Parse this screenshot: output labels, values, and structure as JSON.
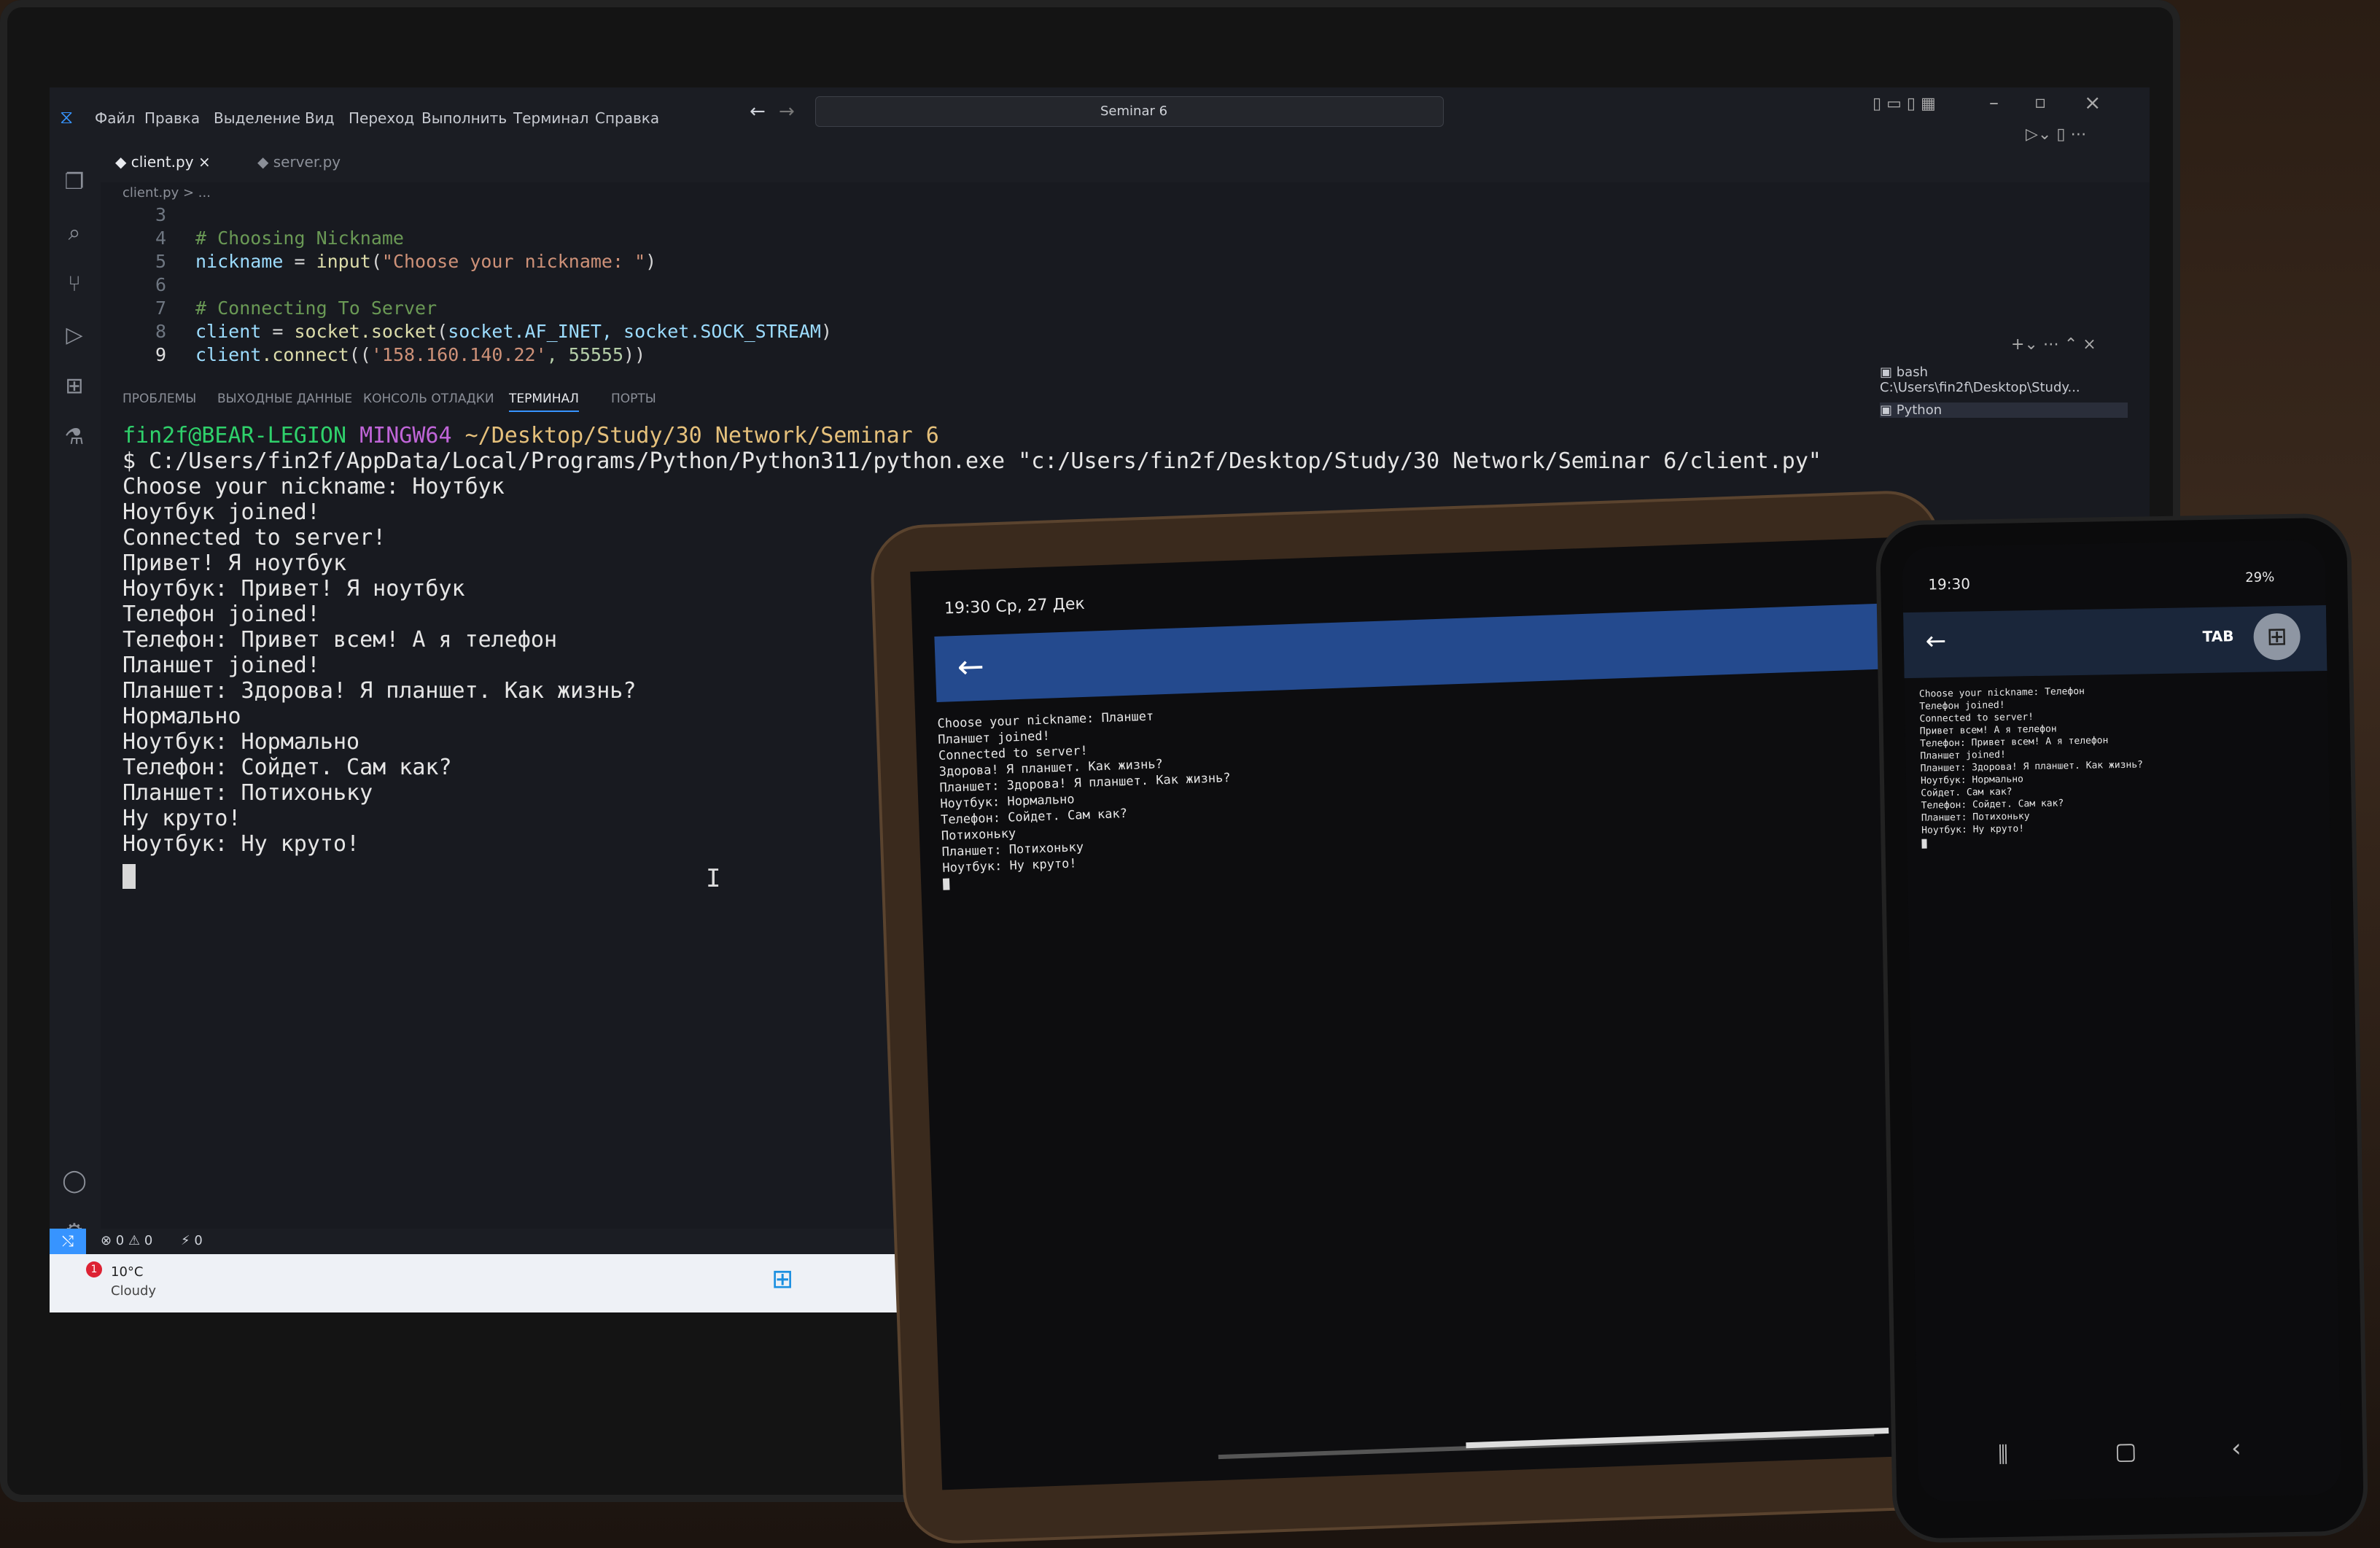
{
  "laptop": {
    "menu": [
      "Файл",
      "Правка",
      "Выделение",
      "Вид",
      "Переход",
      "Выполнить",
      "Терминал",
      "Справка"
    ],
    "search": "Seminar 6",
    "tabs": [
      {
        "label": "client.py",
        "close": "×"
      },
      {
        "label": "server.py"
      }
    ],
    "breadcrumb": "client.py > ...",
    "code": [
      {
        "n": "3"
      },
      {
        "n": "4",
        "comment": "# Choosing Nickname"
      },
      {
        "n": "5",
        "var": "nickname",
        "eq": " = ",
        "fn": "input",
        "open": "(",
        "str": "\"Choose your nickname: \"",
        "close": ")"
      },
      {
        "n": "6"
      },
      {
        "n": "7",
        "comment": "# Connecting To Server"
      },
      {
        "n": "8",
        "var": "client",
        "eq": " = ",
        "fn": "socket.socket",
        "open": "(",
        "args": "socket.AF_INET, socket.SOCK_STREAM",
        "close": ")"
      },
      {
        "n": "9",
        "var": "client",
        "fn": ".connect",
        "open": "((",
        "str": "'158.160.140.22'",
        "num": ", 55555",
        "close": "))"
      }
    ],
    "panel_tabs": [
      "ПРОБЛЕМЫ",
      "ВЫХОДНЫЕ ДАННЫЕ",
      "КОНСОЛЬ ОТЛАДКИ",
      "ТЕРМИНАЛ",
      "ПОРТЫ"
    ],
    "active_panel_tab": "ТЕРМИНАЛ",
    "terminal_list": [
      "bash C:\\Users\\fin2f\\Desktop\\Study...",
      "Python"
    ],
    "prompt": {
      "user": "fin2f@BEAR-LEGION",
      "host": "MINGW64",
      "path": "~/Desktop/Study/30 Network/Seminar 6"
    },
    "command": "$ C:/Users/fin2f/AppData/Local/Programs/Python/Python311/python.exe \"c:/Users/fin2f/Desktop/Study/30 Network/Seminar 6/client.py\"",
    "output": [
      "Choose your nickname: Ноутбук",
      "Ноутбук joined!",
      "Connected to server!",
      "Привет! Я ноутбук",
      "Ноутбук: Привет! Я ноутбук",
      "Телефон joined!",
      "Телефон: Привет всем! А я телефон",
      "Планшет joined!",
      "Планшет: Здорова! Я планшет. Как жизнь?",
      "Нормально",
      "Ноутбук: Нормально",
      "Телефон: Сойдет. Сам как?",
      "Планшет: Потихоньку",
      "Ну круто!",
      "Ноутбук: Ну круто!"
    ],
    "statusbar": {
      "errors": "⊗ 0 ⚠ 0",
      "ports": "⚡ 0"
    },
    "weather": {
      "temp": "10°C",
      "condition": "Cloudy",
      "badge": "1"
    }
  },
  "tablet": {
    "status": "19:30 Ср, 27 Дек",
    "output": [
      "Choose your nickname: Планшет",
      "Планшет joined!",
      "Connected to server!",
      "Здорова! Я планшет. Как жизнь?",
      "Планшет: Здорова! Я планшет. Как жизнь?",
      "Ноутбук: Нормально",
      "Телефон: Сойдет. Сам как?",
      "Потихоньку",
      "Планшет: Потихоньку",
      "Ноутбук: Ну круто!"
    ]
  },
  "phone": {
    "time": "19:30",
    "battery": "29%",
    "tab_label": "TAB",
    "output": [
      "Choose your nickname: Телефон",
      "Телефон joined!",
      "Connected to server!",
      "Привет всем! А я телефон",
      "Телефон: Привет всем! А я телефон",
      "Планшет joined!",
      "Планшет: Здорова! Я планшет. Как жизнь?",
      "Ноутбук: Нормально",
      "Сойдет. Сам как?",
      "Телефон: Сойдет. Сам как?",
      "Планшет: Потихоньку",
      "Ноутбук: Ну круто!"
    ]
  },
  "colors": {
    "accent": "#3794ff",
    "tablet_appbar": "#244a8e",
    "terminal_user": "#2fd16b",
    "terminal_path": "#e5c07b"
  }
}
